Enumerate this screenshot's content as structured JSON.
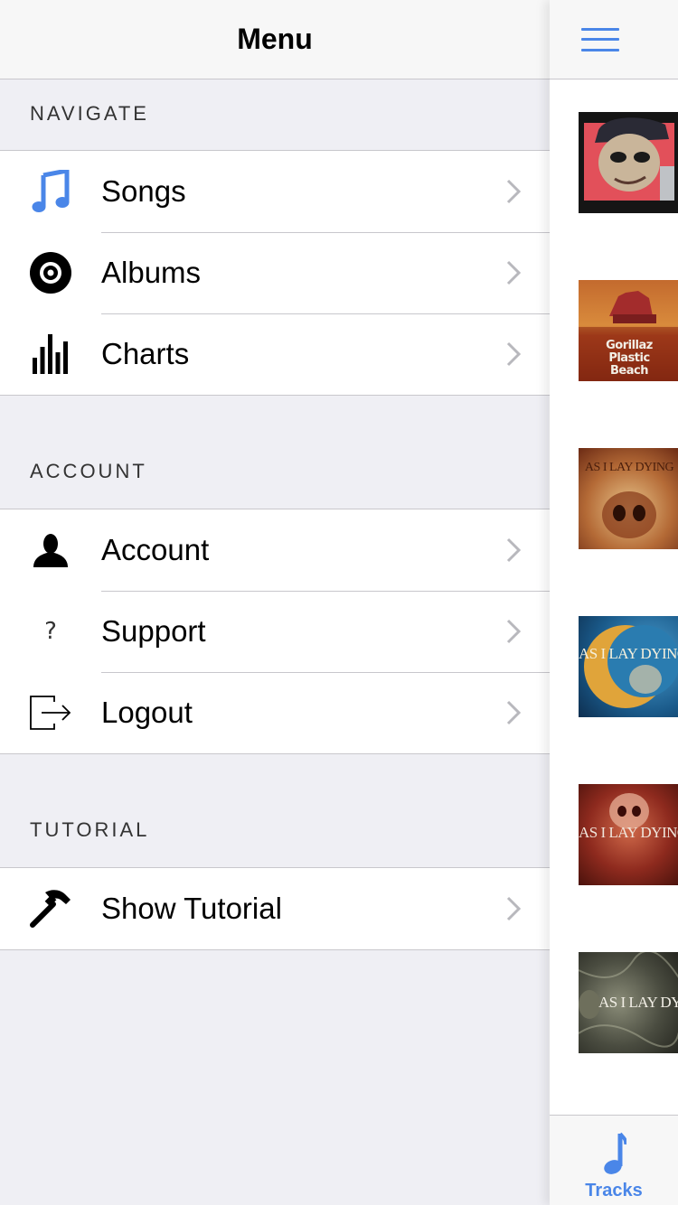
{
  "menu": {
    "title": "Menu",
    "sections": [
      {
        "header": "NAVIGATE",
        "items": [
          {
            "label": "Songs",
            "icon": "music-note-icon"
          },
          {
            "label": "Albums",
            "icon": "album-icon"
          },
          {
            "label": "Charts",
            "icon": "charts-icon"
          }
        ]
      },
      {
        "header": "ACCOUNT",
        "items": [
          {
            "label": "Account",
            "icon": "person-icon"
          },
          {
            "label": "Support",
            "icon": "question-icon"
          },
          {
            "label": "Logout",
            "icon": "logout-icon"
          }
        ]
      },
      {
        "header": "TUTORIAL",
        "items": [
          {
            "label": "Show Tutorial",
            "icon": "hammer-icon"
          }
        ]
      }
    ]
  },
  "main": {
    "menu_button_icon": "hamburger-icon",
    "albums": [
      {
        "art_text": ""
      },
      {
        "art_text": "Gorillaz Plastic Beach"
      },
      {
        "art_text": "AS I LAY DYING"
      },
      {
        "art_text": "AS I LAY DYING"
      },
      {
        "art_text": "AS I LAY DYING"
      },
      {
        "art_text": "AS I LAY DYING"
      }
    ],
    "tab": {
      "label": "Tracks",
      "icon": "music-note-icon"
    }
  },
  "colors": {
    "accent": "#4a86e8",
    "background": "#efeff4",
    "separator": "#c8c7cc"
  }
}
